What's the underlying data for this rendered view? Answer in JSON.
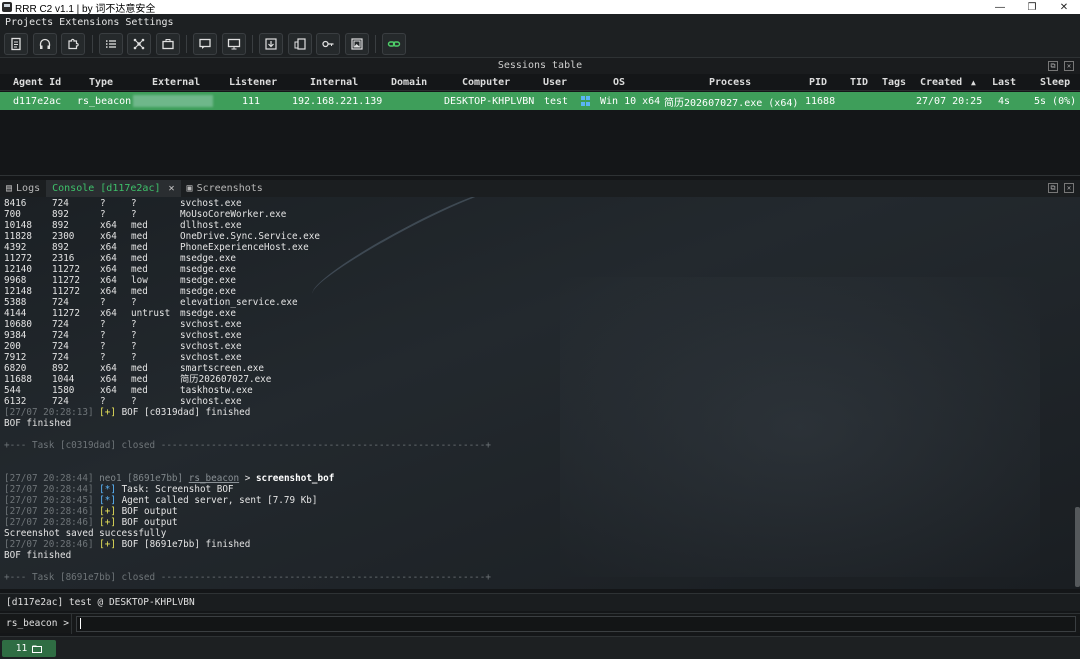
{
  "window": {
    "title": "RRR C2 v1.1 | by 词不达意安全",
    "controls": [
      "—",
      "❐",
      "✕"
    ]
  },
  "menu": [
    "Projects",
    "Extensions",
    "Settings"
  ],
  "toolbar": {
    "icons": [
      "document-icon",
      "headphones-icon",
      "puzzle-icon",
      "list-icon",
      "graph-icon",
      "briefcase-icon",
      "chat-icon",
      "monitor-icon",
      "download-icon",
      "phone-icon",
      "key-icon",
      "image-icon",
      "link-icon"
    ]
  },
  "sessions": {
    "title": "Sessions table",
    "columns": {
      "agent_id": "Agent Id",
      "type": "Type",
      "external": "External",
      "listener": "Listener",
      "internal": "Internal",
      "domain": "Domain",
      "computer": "Computer",
      "user": "User",
      "os": "OS",
      "process": "Process",
      "pid": "PID",
      "tid": "TID",
      "tags": "Tags",
      "created": "Created",
      "sort_arrow": "▲",
      "last": "Last",
      "sleep": "Sleep"
    },
    "row": {
      "agent_id": "d117e2ac",
      "type": "rs_beacon",
      "external": "",
      "listener": "111",
      "internal": "192.168.221.139",
      "domain": "",
      "computer": "DESKTOP-KHPLVBN",
      "user": "test",
      "os": "Win 10 x64",
      "process": "简历202607027.exe (x64)",
      "pid": "11688",
      "tid": "",
      "tags": "",
      "created": "27/07 20:25",
      "last": "4s",
      "sleep": "5s (0%)",
      "row_color": "#3e9e5a"
    }
  },
  "tabs": {
    "logs": "Logs",
    "console": "Console [d117e2ac]",
    "console_close": "✕",
    "screenshots": "Screenshots"
  },
  "console": {
    "process_rows": [
      [
        "8416",
        "724",
        "?",
        "?",
        "",
        "svchost.exe"
      ],
      [
        "700",
        "892",
        "?",
        "?",
        "",
        "MoUsoCoreWorker.exe"
      ],
      [
        "10148",
        "892",
        "x64",
        "med",
        "",
        "dllhost.exe"
      ],
      [
        "11828",
        "2300",
        "x64",
        "med",
        "",
        "OneDrive.Sync.Service.exe"
      ],
      [
        "4392",
        "892",
        "x64",
        "med",
        "",
        "PhoneExperienceHost.exe"
      ],
      [
        "11272",
        "2316",
        "x64",
        "med",
        "",
        "msedge.exe"
      ],
      [
        "12140",
        "11272",
        "x64",
        "med",
        "",
        "msedge.exe"
      ],
      [
        "9968",
        "11272",
        "x64",
        "low",
        "",
        "msedge.exe"
      ],
      [
        "12148",
        "11272",
        "x64",
        "med",
        "",
        "msedge.exe"
      ],
      [
        "5388",
        "724",
        "?",
        "?",
        "",
        "elevation_service.exe"
      ],
      [
        "4144",
        "11272",
        "x64",
        "untrust",
        "",
        "msedge.exe"
      ],
      [
        "10680",
        "724",
        "?",
        "?",
        "",
        "svchost.exe"
      ],
      [
        "9384",
        "724",
        "?",
        "?",
        "",
        "svchost.exe"
      ],
      [
        "200",
        "724",
        "?",
        "?",
        "",
        "svchost.exe"
      ],
      [
        "7912",
        "724",
        "?",
        "?",
        "",
        "svchost.exe"
      ],
      [
        "6820",
        "892",
        "x64",
        "med",
        "",
        "smartscreen.exe"
      ],
      [
        "11688",
        "1044",
        "x64",
        "med",
        "",
        "简历202607027.exe"
      ],
      [
        "544",
        "1580",
        "x64",
        "med",
        "",
        "taskhostw.exe"
      ],
      [
        "6132",
        "724",
        "?",
        "?",
        "",
        "svchost.exe"
      ]
    ],
    "log_a_ts": "[27/07 20:28:13]",
    "log_a_tag": "[+]",
    "log_a_msg": "BOF [c0319dad] finished",
    "bof_finished_1": "BOF finished",
    "task_a_closed": "+--- Task [c0319dad] closed ----------------------------------------------------------+",
    "cmd_ts": "[27/07 20:28:44]",
    "cmd_user": "neo1 [8691e7bb]",
    "cmd_beacon": "rs_beacon",
    "cmd_arrow": ">",
    "cmd_text": "screenshot_bof",
    "l1_ts": "[27/07 20:28:44]",
    "l1_tag": "[*]",
    "l1_msg": "Task: Screenshot BOF",
    "l2_ts": "[27/07 20:28:45]",
    "l2_tag": "[*]",
    "l2_msg": "Agent called server, sent [7.79 Kb]",
    "l3_ts": "[27/07 20:28:46]",
    "l3_tag": "[+]",
    "l3_msg": "BOF output",
    "l4_ts": "[27/07 20:28:46]",
    "l4_tag": "[+]",
    "l4_msg": "BOF output",
    "screenshot_saved": "Screenshot saved successfully",
    "l5_ts": "[27/07 20:28:46]",
    "l5_tag": "[+]",
    "l5_msg": "BOF [8691e7bb] finished",
    "bof_finished_2": "BOF finished",
    "task_b_closed": "+--- Task [8691e7bb] closed ----------------------------------------------------------+"
  },
  "status_line": "[d117e2ac] test @ DESKTOP-KHPLVBN",
  "input": {
    "prompt": "rs_beacon >",
    "value": ""
  },
  "bottom": {
    "count": "11"
  }
}
